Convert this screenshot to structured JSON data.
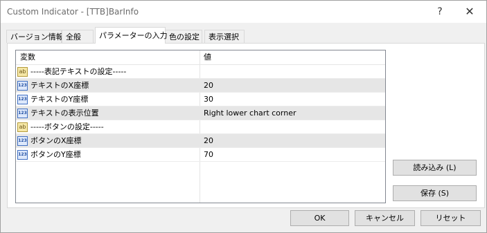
{
  "window": {
    "title": "Custom Indicator - [TTB]BarInfo",
    "help_glyph": "?",
    "close_glyph": "✕"
  },
  "tabs": [
    {
      "label": "バージョン情報"
    },
    {
      "label": "全般"
    },
    {
      "label": "パラメーターの入力"
    },
    {
      "label": "色の設定"
    },
    {
      "label": "表示選択"
    }
  ],
  "table": {
    "headers": {
      "variable": "変数",
      "value": "値"
    },
    "rows": [
      {
        "icon": "ab",
        "name": "-----表記テキストの設定-----",
        "value": ""
      },
      {
        "icon": "123",
        "name": "テキストのX座標",
        "value": "20"
      },
      {
        "icon": "123",
        "name": "テキストのY座標",
        "value": "30"
      },
      {
        "icon": "123",
        "name": "テキストの表示位置",
        "value": "Right lower chart corner"
      },
      {
        "icon": "ab",
        "name": "-----ボタンの設定-----",
        "value": ""
      },
      {
        "icon": "123",
        "name": "ボタンのX座標",
        "value": "20"
      },
      {
        "icon": "123",
        "name": "ボタンのY座標",
        "value": "70"
      }
    ]
  },
  "side_buttons": {
    "load": "読み込み (L)",
    "save": "保存 (S)"
  },
  "footer_buttons": {
    "ok": "OK",
    "cancel": "キャンセル",
    "reset": "リセット"
  }
}
